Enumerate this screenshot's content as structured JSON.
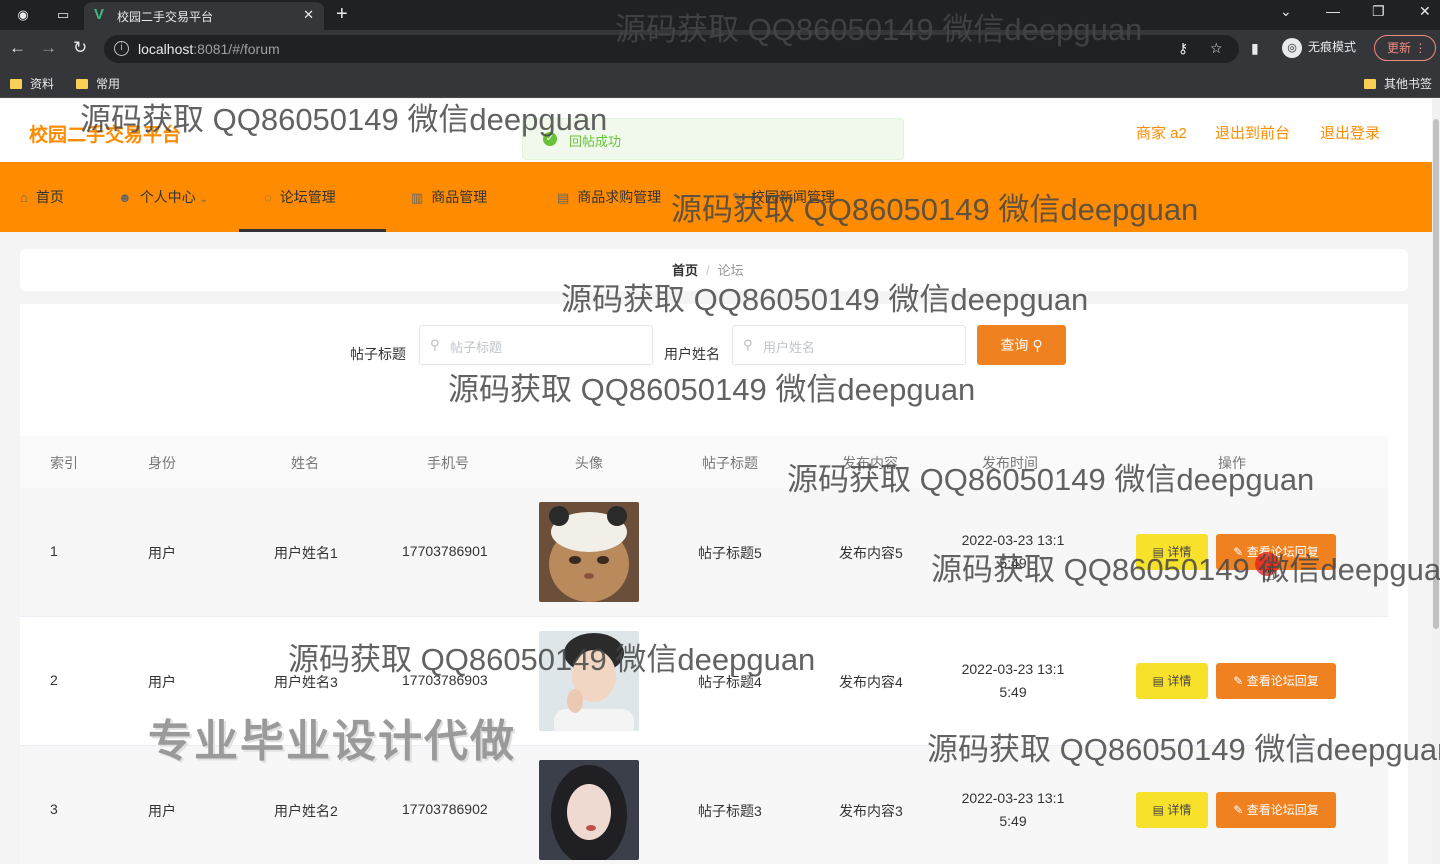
{
  "browser": {
    "tab_title": "校园二手交易平台",
    "url_host": "localhost",
    "url_rest": ":8081/#/forum",
    "incognito_label": "无痕模式",
    "update_label": "更新",
    "bookmarks": [
      "资料",
      "常用"
    ],
    "other_bookmarks": "其他书签"
  },
  "header": {
    "brand": "校园二手交易平台",
    "user_link": "商家 a2",
    "exit_front_link": "退出到前台",
    "logout_link": "退出登录"
  },
  "toast": {
    "message": "回帖成功"
  },
  "nav": {
    "items": [
      {
        "label": "首页",
        "icon": "home-icon"
      },
      {
        "label": "个人中心",
        "icon": "user-icon"
      },
      {
        "label": "论坛管理",
        "icon": "forum-icon"
      },
      {
        "label": "商品管理",
        "icon": "goods-icon"
      },
      {
        "label": "商品求购管理",
        "icon": "purchase-icon"
      },
      {
        "label": "校园新闻管理",
        "icon": "news-icon"
      }
    ]
  },
  "breadcrumb": {
    "home": "首页",
    "separator": "/",
    "current": "论坛"
  },
  "filters": {
    "title_label": "帖子标题",
    "title_placeholder": "帖子标题",
    "name_label": "用户姓名",
    "name_placeholder": "用户姓名",
    "query_label": "查询"
  },
  "table": {
    "columns": [
      "索引",
      "身份",
      "姓名",
      "手机号",
      "头像",
      "帖子标题",
      "发布内容",
      "发布时间",
      "操作"
    ],
    "rows": [
      {
        "index": "1",
        "role": "用户",
        "name": "用户姓名1",
        "phone": "17703786901",
        "title": "帖子标题5",
        "content": "发布内容5",
        "time_line1": "2022-03-23 13:1",
        "time_line2": "5:49",
        "avatar": "cat"
      },
      {
        "index": "2",
        "role": "用户",
        "name": "用户姓名3",
        "phone": "17703786903",
        "title": "帖子标题4",
        "content": "发布内容4",
        "time_line1": "2022-03-23 13:1",
        "time_line2": "5:49",
        "avatar": "man"
      },
      {
        "index": "3",
        "role": "用户",
        "name": "用户姓名2",
        "phone": "17703786902",
        "title": "帖子标题3",
        "content": "发布内容3",
        "time_line1": "2022-03-23 13:1",
        "time_line2": "5:49",
        "avatar": "woman"
      }
    ],
    "detail_label": "详情",
    "reply_label": "查看论坛回复"
  },
  "watermark": "源码获取 QQ86050149 微信deepguan",
  "promo": "专业毕业设计代做",
  "colors": {
    "primary": "#ff8c00",
    "button_orange": "#f08121",
    "button_yellow": "#f8e12b",
    "success": "#67c23a"
  }
}
